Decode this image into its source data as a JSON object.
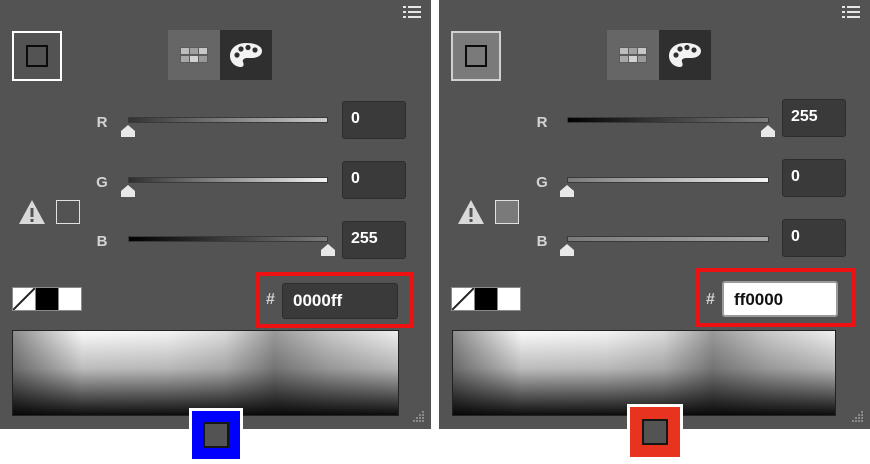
{
  "panels": [
    {
      "id": "left",
      "sliders": [
        {
          "label": "R",
          "value": "0",
          "level": 0
        },
        {
          "label": "G",
          "value": "0",
          "level": 0
        },
        {
          "label": "B",
          "value": "255",
          "level": 1
        }
      ],
      "hash": "#",
      "hex_value": "0000ff",
      "hex_focused": false,
      "fill_color": "#0000ff"
    },
    {
      "id": "right",
      "sliders": [
        {
          "label": "R",
          "value": "255",
          "level": 1
        },
        {
          "label": "G",
          "value": "0",
          "level": 0
        },
        {
          "label": "B",
          "value": "0",
          "level": 0
        }
      ],
      "hash": "#",
      "hex_value": "ff0000",
      "hex_focused": true,
      "fill_color": "#ff0000"
    }
  ],
  "colors": {
    "panel_bg": "#535353",
    "highlight": "#ee1111",
    "left_swatch": "#0000ff",
    "right_swatch": "#e8341f"
  },
  "icons": [
    "menu-icon",
    "fill-stroke-swatch",
    "swatch-grid-icon",
    "palette-icon",
    "warning-icon",
    "no-color-icon",
    "resize-grip-icon"
  ]
}
